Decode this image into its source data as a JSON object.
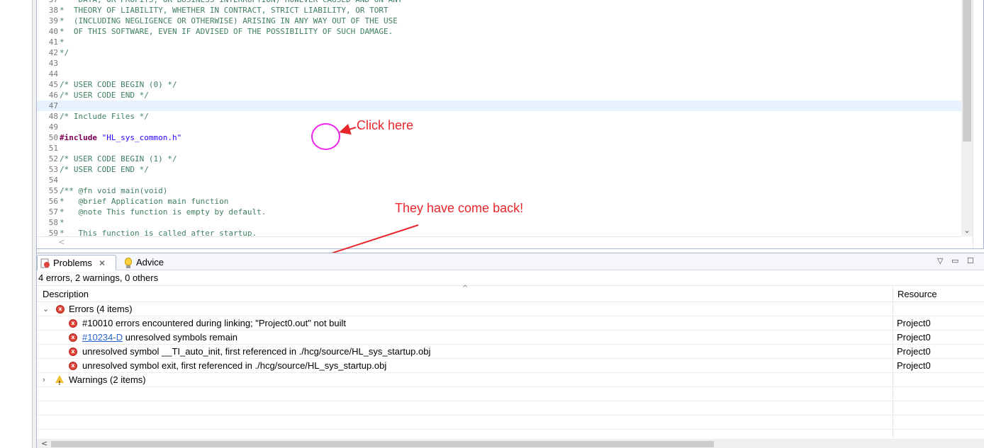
{
  "editor": {
    "lines": [
      {
        "num": "37",
        "kind": "comment",
        "text": "*   DATA, OR PROFITS; OR BUSINESS INTERRUPTION) HOWEVER CAUSED AND ON ANY"
      },
      {
        "num": "38",
        "kind": "comment",
        "text": "*  THEORY OF LIABILITY, WHETHER IN CONTRACT, STRICT LIABILITY, OR TORT"
      },
      {
        "num": "39",
        "kind": "comment",
        "text": "*  (INCLUDING NEGLIGENCE OR OTHERWISE) ARISING IN ANY WAY OUT OF THE USE"
      },
      {
        "num": "40",
        "kind": "comment",
        "text": "*  OF THIS SOFTWARE, EVEN IF ADVISED OF THE POSSIBILITY OF SUCH DAMAGE."
      },
      {
        "num": "41",
        "kind": "comment",
        "text": "*"
      },
      {
        "num": "42",
        "kind": "comment",
        "text": "*/"
      },
      {
        "num": "43",
        "kind": "blank",
        "text": ""
      },
      {
        "num": "44",
        "kind": "blank",
        "text": ""
      },
      {
        "num": "45",
        "kind": "comment",
        "text": "/* USER CODE BEGIN (0) */"
      },
      {
        "num": "46",
        "kind": "comment",
        "text": "/* USER CODE END */"
      },
      {
        "num": "47",
        "kind": "current",
        "text": ""
      },
      {
        "num": "48",
        "kind": "comment",
        "text": "/* Include Files */"
      },
      {
        "num": "49",
        "kind": "blank",
        "text": ""
      },
      {
        "num": "50",
        "kind": "include",
        "keyword": "#include",
        "text": "\"HL_sys_common.h\""
      },
      {
        "num": "51",
        "kind": "blank",
        "text": ""
      },
      {
        "num": "52",
        "kind": "comment",
        "text": "/* USER CODE BEGIN (1) */"
      },
      {
        "num": "53",
        "kind": "comment",
        "text": "/* USER CODE END */"
      },
      {
        "num": "54",
        "kind": "blank",
        "text": ""
      },
      {
        "num": "55",
        "kind": "comment",
        "text": "/** @fn void main(void)"
      },
      {
        "num": "56",
        "kind": "comment",
        "text": "*   @brief Application main function"
      },
      {
        "num": "57",
        "kind": "comment",
        "text": "*   @note This function is empty by default."
      },
      {
        "num": "58",
        "kind": "comment",
        "text": "*"
      },
      {
        "num": "59",
        "kind": "comment",
        "text": "*   This function is called after startup."
      }
    ]
  },
  "annotations": {
    "click_here": "Click here",
    "come_back": "They have come back!",
    "arrow_color": "#e8262c",
    "circle_color": "#ee22ee"
  },
  "panel": {
    "tabs": [
      {
        "label": "Problems",
        "close": "✕"
      },
      {
        "label": "Advice"
      }
    ],
    "view_menu": "▽",
    "minimize": "▭",
    "maximize": "☐",
    "summary": "4 errors, 2 warnings, 0 others",
    "columns": {
      "description": "Description",
      "resource": "Resource",
      "sort": "^"
    },
    "error_group": {
      "twisty": "⌄",
      "label": "Errors (4 items)",
      "items": [
        {
          "code": "",
          "text": "#10010 errors encountered during linking; \"Project0.out\" not built",
          "resource": "Project0"
        },
        {
          "code": "#10234-D",
          "text": " unresolved symbols remain",
          "resource": "Project0"
        },
        {
          "code": "",
          "text": "unresolved symbol __TI_auto_init, first referenced in ./hcg/source/HL_sys_startup.obj",
          "resource": "Project0"
        },
        {
          "code": "",
          "text": "unresolved symbol exit, first referenced in ./hcg/source/HL_sys_startup.obj",
          "resource": "Project0"
        }
      ]
    },
    "warning_group": {
      "twisty": "›",
      "label": "Warnings (2 items)"
    },
    "scroll_left": "<",
    "error_glyph": "x",
    "warning_glyph": "!"
  }
}
